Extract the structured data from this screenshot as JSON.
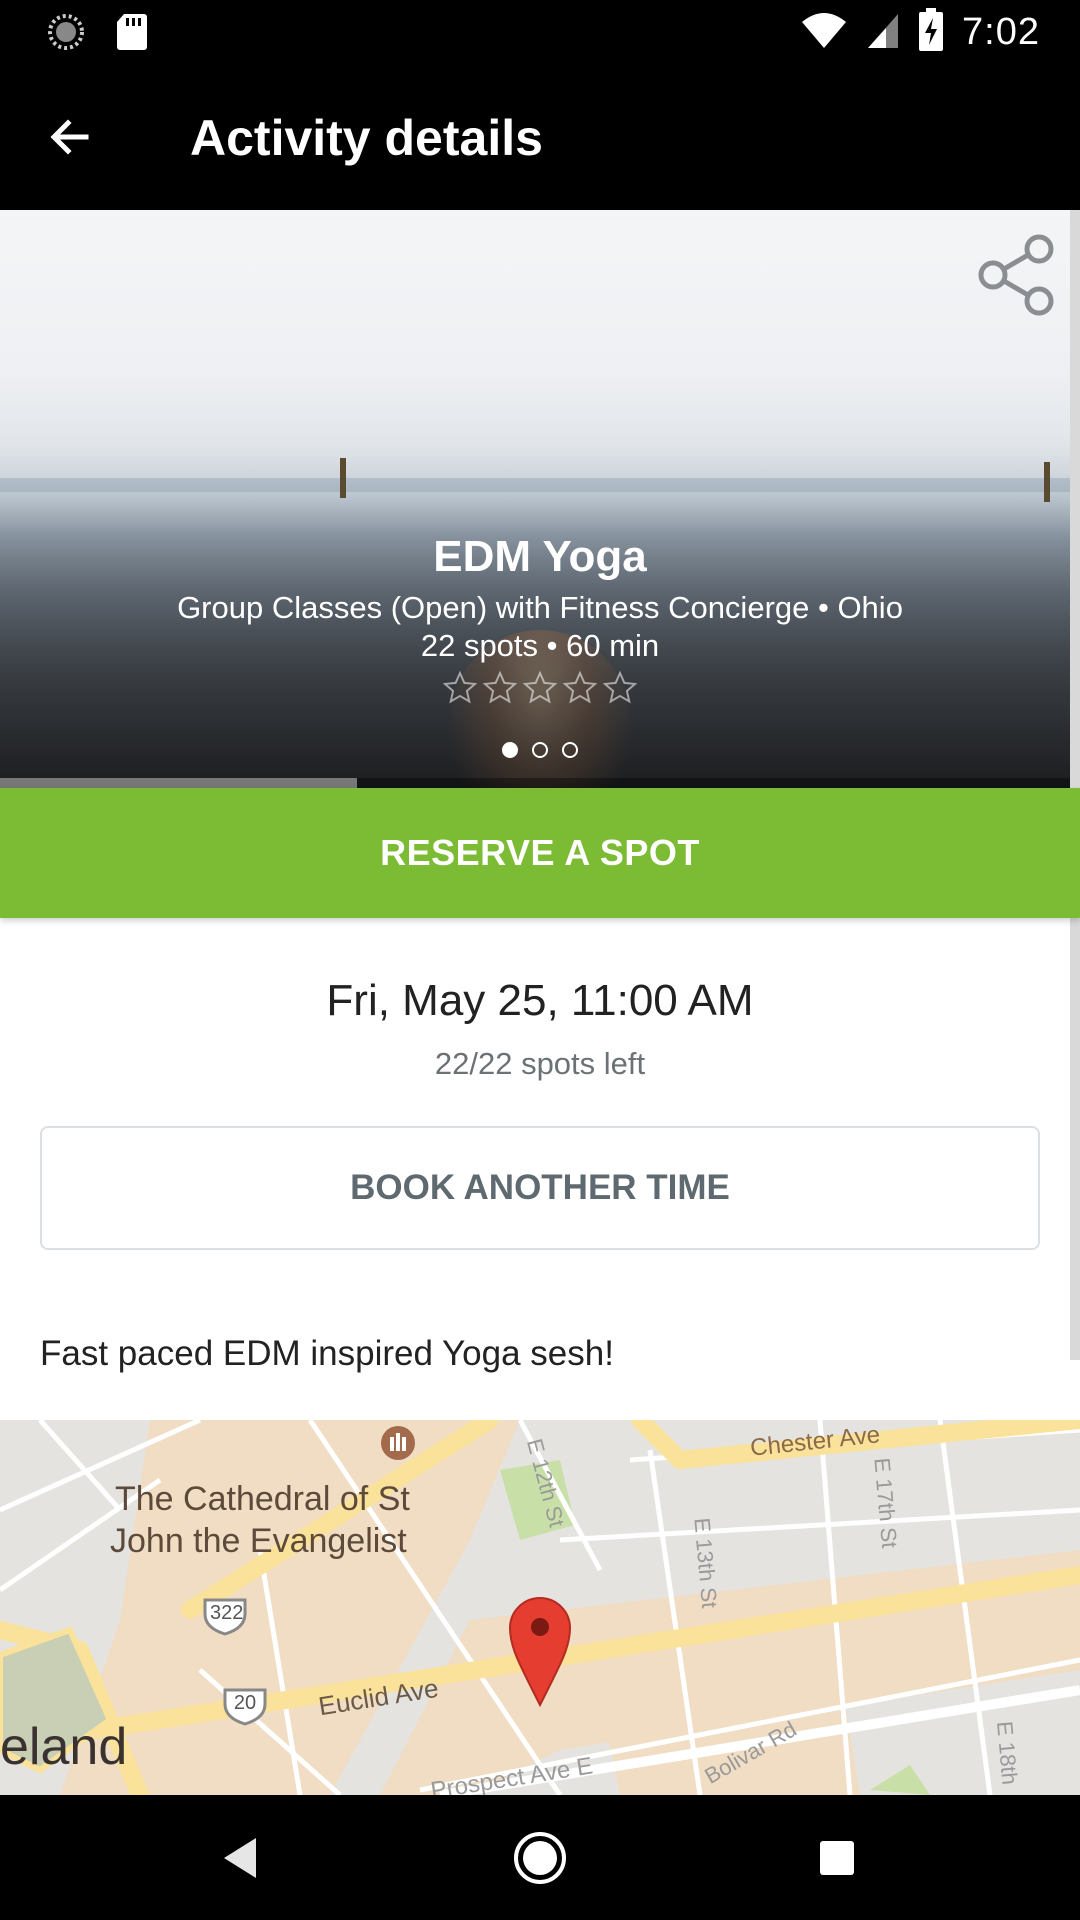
{
  "status_bar": {
    "time": "7:02",
    "icons_left": [
      "sync-icon",
      "sd-card-icon"
    ],
    "icons_right": [
      "wifi-icon",
      "cell-signal-icon",
      "battery-charging-icon"
    ]
  },
  "app_bar": {
    "title": "Activity details",
    "back_icon": "arrow-back-icon"
  },
  "activity": {
    "title": "EDM Yoga",
    "subtitle": "Group Classes (Open) with Fitness Concierge  •  Ohio",
    "meta": "22 spots  •  60 min",
    "rating": 0,
    "rating_max": 5,
    "image_count": 3,
    "image_index": 1,
    "share_icon": "share-icon"
  },
  "reserve_button": {
    "label": "RESERVE A SPOT"
  },
  "session": {
    "datetime": "Fri, May 25, 11:00 AM",
    "spots_left": "22/22 spots left"
  },
  "book_button": {
    "label": "BOOK ANOTHER TIME"
  },
  "description": "Fast paced EDM inspired Yoga sesh!",
  "map": {
    "poi": [
      "The Cathedral of St",
      "John the Evangelist"
    ],
    "streets": [
      "Chester Ave",
      "E 12th St",
      "E 13th St",
      "E 17th St",
      "Euclid Ave",
      "Prospect Ave E",
      "Bolivar Rd",
      "E 18th"
    ],
    "route_shields": [
      "322",
      "20"
    ],
    "city": "eland",
    "marker_icon": "map-marker-icon"
  },
  "nav_bar": {
    "back": "nav-back-icon",
    "home": "nav-home-icon",
    "recents": "nav-recents-icon"
  },
  "colors": {
    "accent_green": "#7cbb34",
    "status_bar": "#000000",
    "app_bar": "#000000"
  }
}
